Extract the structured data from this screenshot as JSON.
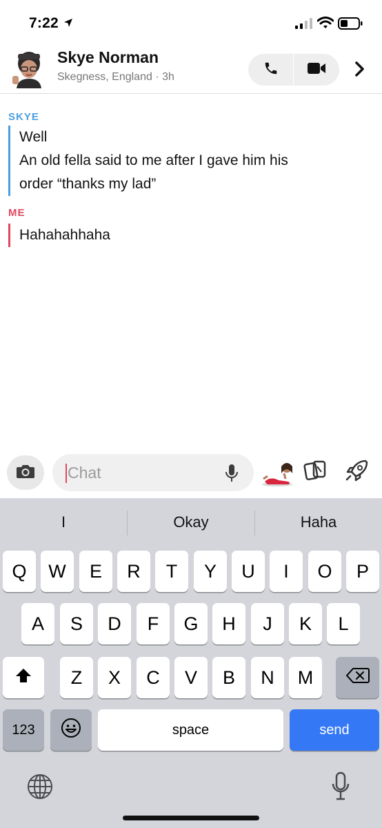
{
  "status_bar": {
    "time": "7:22"
  },
  "header": {
    "name": "Skye Norman",
    "subtitle": "Skegness, England · 3h"
  },
  "messages": [
    {
      "sender": "SKYE",
      "lines": [
        "Well",
        "An old fella said to me after I gave him his",
        "order “thanks my lad”"
      ]
    },
    {
      "sender": "ME",
      "lines": [
        "Hahahahhaha"
      ]
    }
  ],
  "input": {
    "placeholder": "Chat"
  },
  "keyboard": {
    "suggestions": [
      "I",
      "Okay",
      "Haha"
    ],
    "row1": [
      "Q",
      "W",
      "E",
      "R",
      "T",
      "Y",
      "U",
      "I",
      "O",
      "P"
    ],
    "row2": [
      "A",
      "S",
      "D",
      "F",
      "G",
      "H",
      "J",
      "K",
      "L"
    ],
    "row3": [
      "Z",
      "X",
      "C",
      "V",
      "B",
      "N",
      "M"
    ],
    "numbers_label": "123",
    "space_label": "space",
    "send_label": "send"
  },
  "colors": {
    "skye_accent": "#4a9fe0",
    "me_accent": "#e2465f",
    "send_button": "#3478f6"
  },
  "icons": [
    "location-arrow-icon",
    "signal-icon",
    "wifi-icon",
    "battery-icon",
    "phone-icon",
    "video-icon",
    "chevron-right-icon",
    "camera-icon",
    "mic-icon",
    "bitmoji-icon",
    "cards-icon",
    "rocket-icon",
    "shift-icon",
    "backspace-icon",
    "emoji-icon",
    "globe-icon",
    "dictation-icon"
  ]
}
